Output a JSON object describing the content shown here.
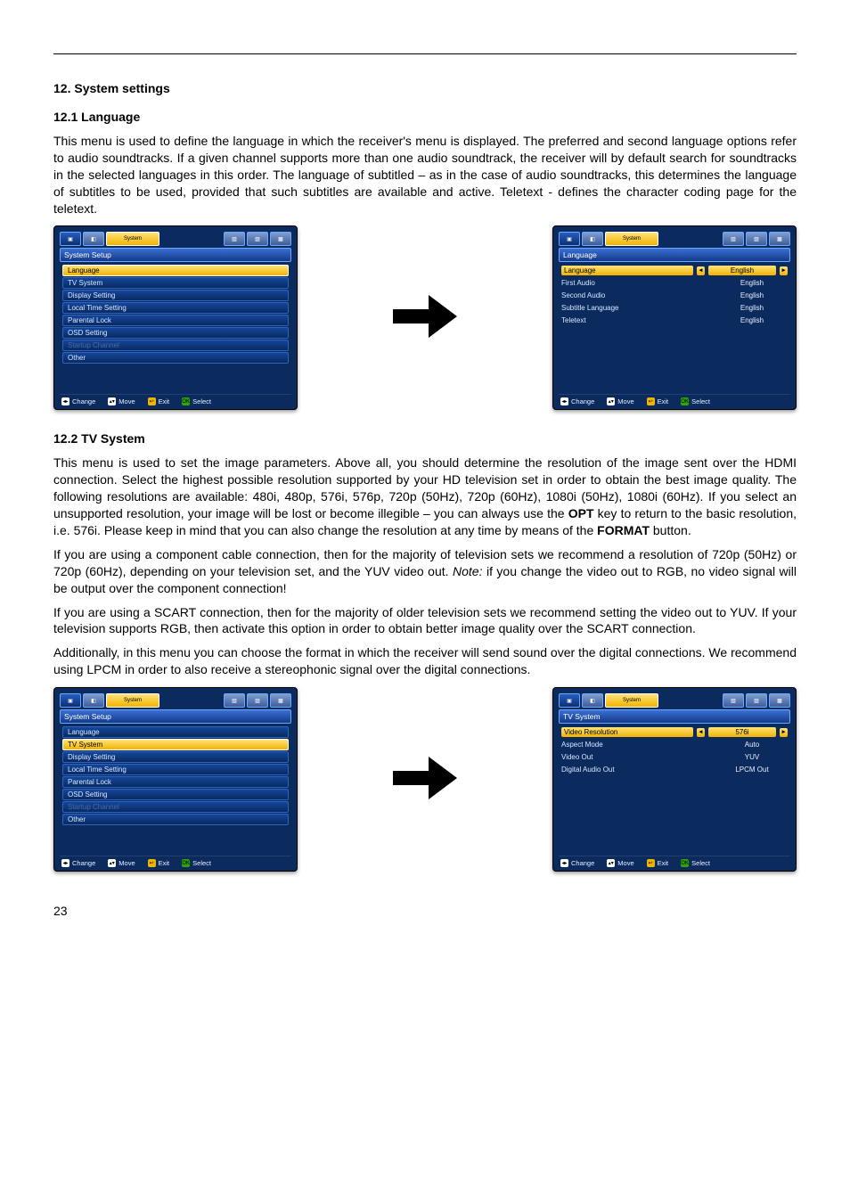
{
  "headings": {
    "h12": "12. System settings",
    "h12_1": "12.1 Language",
    "h12_2": "12.2 TV System"
  },
  "para": {
    "p12_1": "This menu is used to define the language in which the receiver's menu is displayed. The preferred and second language options refer to audio soundtracks. If a given channel supports more than one audio soundtrack, the receiver will by default search for soundtracks in the selected languages in this order. The language of subtitled – as in the case of audio soundtracks, this determines the language of subtitles to be used, provided that such subtitles are available and active. Teletext - defines the character coding page for the teletext.",
    "p12_2a_pre": "This menu is used to set the image parameters. Above all, you should determine the resolution of the image sent over the HDMI connection. Select the highest possible resolution supported by your HD television set in order to obtain the best image quality. The following resolutions are available: 480i, 480p, 576i, 576p, 720p (50Hz), 720p (60Hz), 1080i (50Hz), 1080i (60Hz). If you select an unsupported resolution, your image will be lost or become illegible – you can always use the ",
    "p12_2a_opt": "OPT",
    "p12_2a_mid": " key to return to the basic resolution, i.e. 576i. Please keep in mind that you can also change the resolution at any time by means of the ",
    "p12_2a_fmt": "FORMAT",
    "p12_2a_post": " button.",
    "p12_2b_pre": "If you are using a component cable connection, then for the majority of television sets we recommend a resolution of 720p (50Hz) or 720p (60Hz), depending on your television set, and the YUV video out. ",
    "p12_2b_note": "Note:",
    "p12_2b_post": " if you change the video out to RGB, no video signal will be output over the component connection!",
    "p12_2c": "If you are using a SCART connection, then for the majority of older television sets we recommend setting the video out to YUV. If your television supports RGB, then activate this option in order to obtain better image quality over the SCART connection.",
    "p12_2d": "Additionally, in this menu you can choose the format in which the receiver will send sound over the digital connections. We recommend using LPCM in order to also receive a stereophonic signal over the digital connections."
  },
  "rx_common": {
    "tab_active": "System",
    "footer": {
      "change": "Change",
      "move": "Move",
      "exit": "Exit",
      "select": "Select",
      "change_key": "◂▸",
      "move_key": "▴▾",
      "exit_key": "↩",
      "select_key": "OK"
    }
  },
  "rx1": {
    "title": "System Setup",
    "items": [
      {
        "label": "Language",
        "sel": true
      },
      {
        "label": "TV System"
      },
      {
        "label": "Display Setting"
      },
      {
        "label": "Local Time Setting"
      },
      {
        "label": "Parental Lock"
      },
      {
        "label": "OSD Setting"
      },
      {
        "label": "Startup Channel",
        "dim": true
      },
      {
        "label": "Other"
      }
    ]
  },
  "rx2": {
    "title": "Language",
    "items": [
      {
        "label": "Language",
        "val": "English",
        "sel": true
      },
      {
        "label": "First Audio",
        "val": "English"
      },
      {
        "label": "Second Audio",
        "val": "English"
      },
      {
        "label": "Subtitle Language",
        "val": "English"
      },
      {
        "label": "Teletext",
        "val": "English"
      }
    ]
  },
  "rx3": {
    "title": "System Setup",
    "items": [
      {
        "label": "Language"
      },
      {
        "label": "TV System",
        "sel": true
      },
      {
        "label": "Display Setting"
      },
      {
        "label": "Local Time Setting"
      },
      {
        "label": "Parental Lock"
      },
      {
        "label": "OSD Setting"
      },
      {
        "label": "Startup Channel",
        "dim": true
      },
      {
        "label": "Other"
      }
    ]
  },
  "rx4": {
    "title": "TV System",
    "items": [
      {
        "label": "Video Resolution",
        "val": "576i",
        "sel": true
      },
      {
        "label": "Aspect Mode",
        "val": "Auto"
      },
      {
        "label": "Video Out",
        "val": "YUV"
      },
      {
        "label": "Digital Audio Out",
        "val": "LPCM Out"
      }
    ]
  },
  "page_number": "23"
}
